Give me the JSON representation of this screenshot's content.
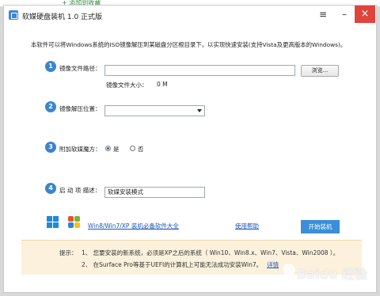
{
  "page": {
    "crumb": "+ 添加到收藏"
  },
  "window": {
    "title": "软媒硬盘装机 1.0 正式版",
    "menu_icon": "≡",
    "min_icon": "–",
    "close_icon": "×"
  },
  "intro": "本软件可以将Windows系统的ISO镜像解压到某磁盘分区根目录下，以实现快速安装(支持Vista及更高版本的Windows)。",
  "step1": {
    "num": "1",
    "label": "镜像文件路径：",
    "path_value": "",
    "browse_label": "浏览...",
    "size_label": "镜像文件大小：",
    "size_value": "0 M"
  },
  "step2": {
    "num": "2",
    "label": "镜像解压位置：",
    "selected": ""
  },
  "step3": {
    "num": "3",
    "label": "附加软媒魔方：",
    "yes": "是",
    "no": "否",
    "selected": "yes"
  },
  "step4": {
    "num": "4",
    "label": "启 动 项 描述：",
    "value": "软媒安装模式"
  },
  "footer": {
    "link_main": "Win8/Win7/XP 装机必备软件大全",
    "link_help": "使用帮助",
    "start_label": "开始装机"
  },
  "tips": {
    "head": "提示：",
    "line1": "1、 您要安装的新系统，必须是XP之后的系统（ Win10、Win8.x、Win7、Vista、Win2008 ）。",
    "line2": "2、 在Surface Pro等基于UEFI的计算机上可能无法成功安装Win7。",
    "line2_link": "详情"
  },
  "watermark": {
    "text": "Baidu 经验",
    "sub": "jingyan.baidu.com"
  },
  "colors": {
    "accent": "#3a85cf",
    "close": "#e0443b",
    "link": "#1a56b8",
    "tip_bg": "#fbf1dc"
  }
}
